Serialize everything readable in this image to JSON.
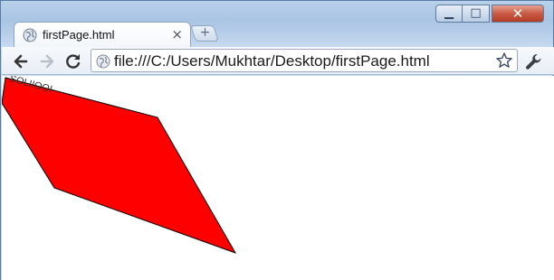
{
  "tab": {
    "title": "firstPage.html",
    "close_label": "×"
  },
  "new_tab": {
    "label": "+"
  },
  "window_controls": {
    "minimize_label": "▁",
    "maximize_label": "□",
    "close_label": "✕"
  },
  "toolbar": {
    "back_icon": "back-arrow-icon",
    "forward_icon": "forward-arrow-icon",
    "reload_icon": "reload-icon",
    "bookmark_icon": "star-icon",
    "wrench_icon": "wrench-icon"
  },
  "omnibox": {
    "url": "file:///C:/Users/Mukhtar/Desktop/firstPage.html"
  },
  "content": {
    "shape_color": "#ff0000",
    "shape_stroke": "#000000",
    "shape_text": "SOLIIOOI"
  }
}
